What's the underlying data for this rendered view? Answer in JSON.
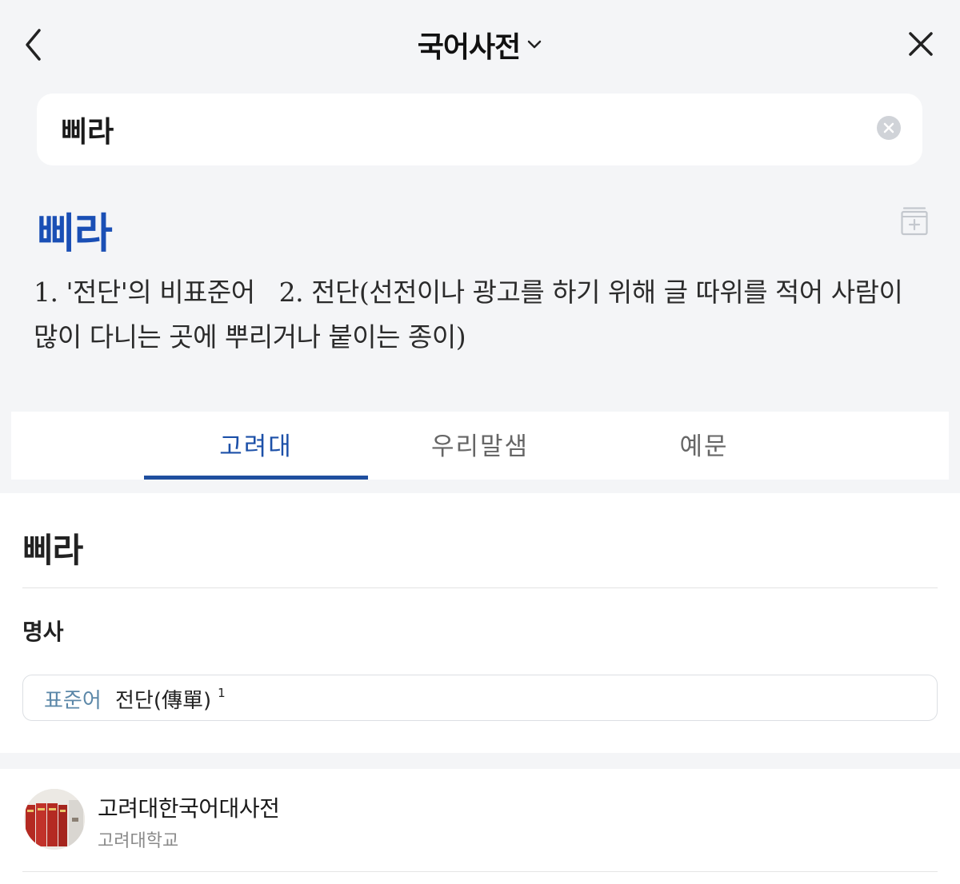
{
  "header": {
    "title": "국어사전",
    "back_icon": "chevron-left-icon",
    "close_icon": "close-icon",
    "dropdown_icon": "chevron-down-icon"
  },
  "search": {
    "value": "삐라",
    "clear_icon": "clear-circle-icon"
  },
  "entry": {
    "word": "삐라",
    "summary_1": "1.  '전단'의 비표준어",
    "summary_2": "2.  전단(선전이나 광고를 하기 위해 글 따위를 적어 사람이 많이 다니는 곳에 뿌리거나 붙이는 종이)",
    "wordbook_icon": "add-to-wordbook-icon"
  },
  "tabs": [
    {
      "label": "고려대",
      "active": true
    },
    {
      "label": "우리말샘",
      "active": false
    },
    {
      "label": "예문",
      "active": false
    }
  ],
  "detail": {
    "word": "삐라",
    "part_of_speech": "명사",
    "standard_label": "표준어",
    "standard_word": "전단(傳單)",
    "standard_sup": "1"
  },
  "source": {
    "name": "고려대한국어대사전",
    "org": "고려대학교"
  },
  "colors": {
    "accent": "#1a4fb5",
    "tab_indicator": "#1f4f9f",
    "background": "#f4f5f7",
    "standard_label": "#5b87a8"
  }
}
